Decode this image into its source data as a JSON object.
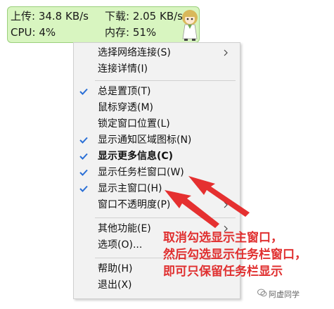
{
  "widget": {
    "upload": "上传: 34.8 KB/s",
    "download": "下载: 2.05 KB/s",
    "cpu": "CPU: 4%",
    "memory": "内存: 51%"
  },
  "menu": {
    "items": [
      {
        "label": "选择网络连接(S)",
        "checked": false,
        "submenu": true
      },
      {
        "label": "连接详情(I)",
        "checked": false,
        "submenu": false
      },
      {
        "label": "总是置顶(T)",
        "checked": true,
        "submenu": false
      },
      {
        "label": "鼠标穿透(M)",
        "checked": false,
        "submenu": false
      },
      {
        "label": "锁定窗口位置(L)",
        "checked": false,
        "submenu": false
      },
      {
        "label": "显示通知区域图标(N)",
        "checked": true,
        "submenu": false
      },
      {
        "label": "显示更多信息(C)",
        "checked": true,
        "submenu": false
      },
      {
        "label": "显示任务栏窗口(W)",
        "checked": true,
        "submenu": false
      },
      {
        "label": "显示主窗口(H)",
        "checked": true,
        "submenu": false
      },
      {
        "label": "窗口不透明度(P)",
        "checked": false,
        "submenu": true
      },
      {
        "label": "其他功能(E)",
        "checked": false,
        "submenu": true
      },
      {
        "label": "选项(O)...",
        "checked": false,
        "submenu": false
      },
      {
        "label": "帮助(H)",
        "checked": false,
        "submenu": false
      },
      {
        "label": "退出(X)",
        "checked": false,
        "submenu": false
      }
    ]
  },
  "annotation": {
    "line1": "取消勾选显示主窗口，",
    "line2": "然后勾选显示任务栏窗口，",
    "line3": "即可只保留任务栏显示"
  },
  "watermark": {
    "text": "阿虚同学"
  },
  "colors": {
    "widget_bg": "#d8f5c0",
    "check": "#2a6fd6",
    "annotation": "#e03030"
  }
}
